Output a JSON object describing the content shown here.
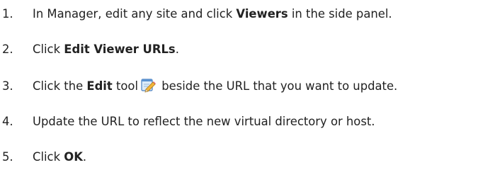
{
  "steps": [
    {
      "number": "1.",
      "text_before": "In Manager, edit any site and click ",
      "bold": "Viewers",
      "text_after": " in the side panel."
    },
    {
      "number": "2.",
      "text_before": "Click ",
      "bold": "Edit Viewer URLs",
      "text_after": "."
    },
    {
      "number": "3.",
      "text_before": "Click the ",
      "bold": "Edit",
      "text_middle": " tool",
      "icon": "edit-pencil-icon",
      "text_after": " beside the URL that you want to update."
    },
    {
      "number": "4.",
      "text": "Update the URL to reflect the new virtual directory or host."
    },
    {
      "number": "5.",
      "text_before": "Click ",
      "bold": "OK",
      "text_after": "."
    }
  ]
}
